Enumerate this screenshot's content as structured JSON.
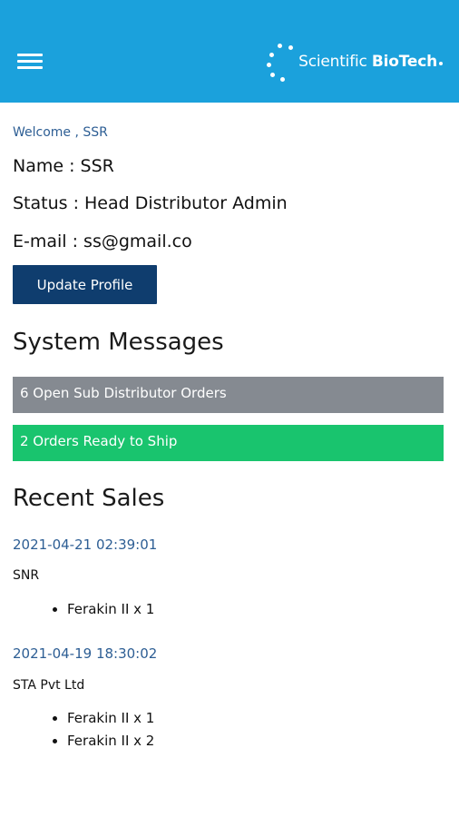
{
  "header": {
    "brand_light": "Scientific",
    "brand_bold": "BioTech",
    "menu_icon": "hamburger-menu-icon",
    "bg_color": "#1ba1dc"
  },
  "profile": {
    "welcome": "Welcome , SSR",
    "name": "Name : SSR",
    "status": "Status : Head Distributor Admin",
    "email": "E-mail : ss@gmail.co",
    "update_button": "Update Profile"
  },
  "system_messages": {
    "title": "System Messages",
    "items": [
      {
        "text": "6 Open Sub Distributor Orders",
        "color": "#858a91"
      },
      {
        "text": "2 Orders Ready to Ship",
        "color": "#19c46e"
      }
    ]
  },
  "recent_sales": {
    "title": "Recent Sales",
    "sales": [
      {
        "date": "2021-04-21 02:39:01",
        "customer": "SNR",
        "items": [
          "Ferakin II x 1"
        ]
      },
      {
        "date": "2021-04-19 18:30:02",
        "customer": "STA Pvt Ltd",
        "items": [
          "Ferakin II x 1",
          "Ferakin II x 2"
        ]
      }
    ]
  }
}
